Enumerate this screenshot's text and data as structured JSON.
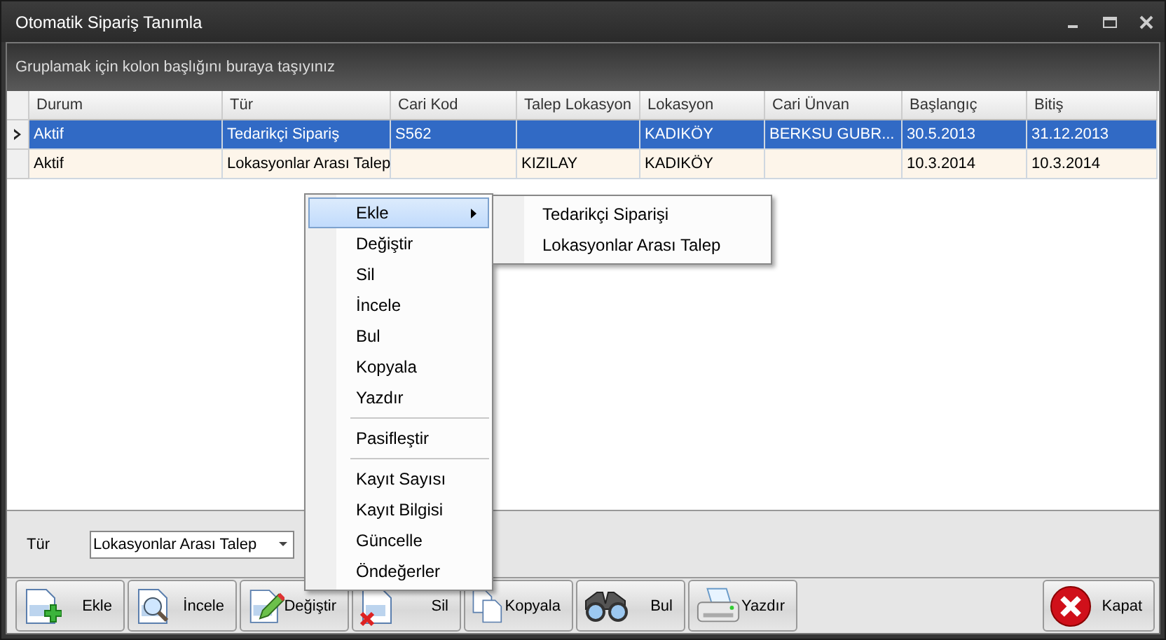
{
  "window": {
    "title": "Otomatik Sipariş Tanımla"
  },
  "group_panel": {
    "hint": "Gruplamak için kolon başlığını buraya taşıyınız"
  },
  "table": {
    "columns": [
      "Durum",
      "Tür",
      "Cari Kod",
      "Talep Lokasyon",
      "Lokasyon",
      "Cari Ünvan",
      "Başlangıç",
      "Bitiş"
    ],
    "rows": [
      {
        "selected": true,
        "cells": [
          "Aktif",
          "Tedarikçi Sipariş",
          "S562",
          "",
          "KADIKÖY",
          "BERKSU GUBR...",
          "30.5.2013",
          "31.12.2013"
        ]
      },
      {
        "selected": false,
        "cells": [
          "Aktif",
          "Lokasyonlar Arası Talep",
          "",
          "KIZILAY",
          "KADIKÖY",
          "",
          "10.3.2014",
          "10.3.2014"
        ]
      }
    ]
  },
  "filter": {
    "label": "Tür",
    "value": "Lokasyonlar Arası Talep"
  },
  "context_menu": {
    "items": [
      {
        "kind": "item",
        "label": "Ekle",
        "selected": true,
        "submenu": true
      },
      {
        "kind": "item",
        "label": "Değiştir",
        "selected": false,
        "submenu": false
      },
      {
        "kind": "item",
        "label": "Sil",
        "selected": false,
        "submenu": false
      },
      {
        "kind": "item",
        "label": "İncele",
        "selected": false,
        "submenu": false
      },
      {
        "kind": "item",
        "label": "Bul",
        "selected": false,
        "submenu": false
      },
      {
        "kind": "item",
        "label": "Kopyala",
        "selected": false,
        "submenu": false
      },
      {
        "kind": "item",
        "label": "Yazdır",
        "selected": false,
        "submenu": false
      },
      {
        "kind": "separator"
      },
      {
        "kind": "item",
        "label": "Pasifleştir",
        "selected": false,
        "submenu": false
      },
      {
        "kind": "separator"
      },
      {
        "kind": "item",
        "label": "Kayıt Sayısı",
        "selected": false,
        "submenu": false
      },
      {
        "kind": "item",
        "label": "Kayıt Bilgisi",
        "selected": false,
        "submenu": false
      },
      {
        "kind": "item",
        "label": "Güncelle",
        "selected": false,
        "submenu": false
      },
      {
        "kind": "item",
        "label": "Öndeğerler",
        "selected": false,
        "submenu": false
      }
    ],
    "submenu": [
      "Tedarikçi Siparişi",
      "Lokasyonlar Arası Talep"
    ]
  },
  "toolbar": [
    {
      "kind": "add",
      "label": "Ekle"
    },
    {
      "kind": "view",
      "label": "İncele"
    },
    {
      "kind": "edit",
      "label": "Değiştir"
    },
    {
      "kind": "delete",
      "label": "Sil"
    },
    {
      "kind": "copy",
      "label": "Kopyala"
    },
    {
      "kind": "find",
      "label": "Bul"
    },
    {
      "kind": "print",
      "label": "Yazdır"
    }
  ],
  "close_button": {
    "kind": "close",
    "label": "Kapat"
  }
}
